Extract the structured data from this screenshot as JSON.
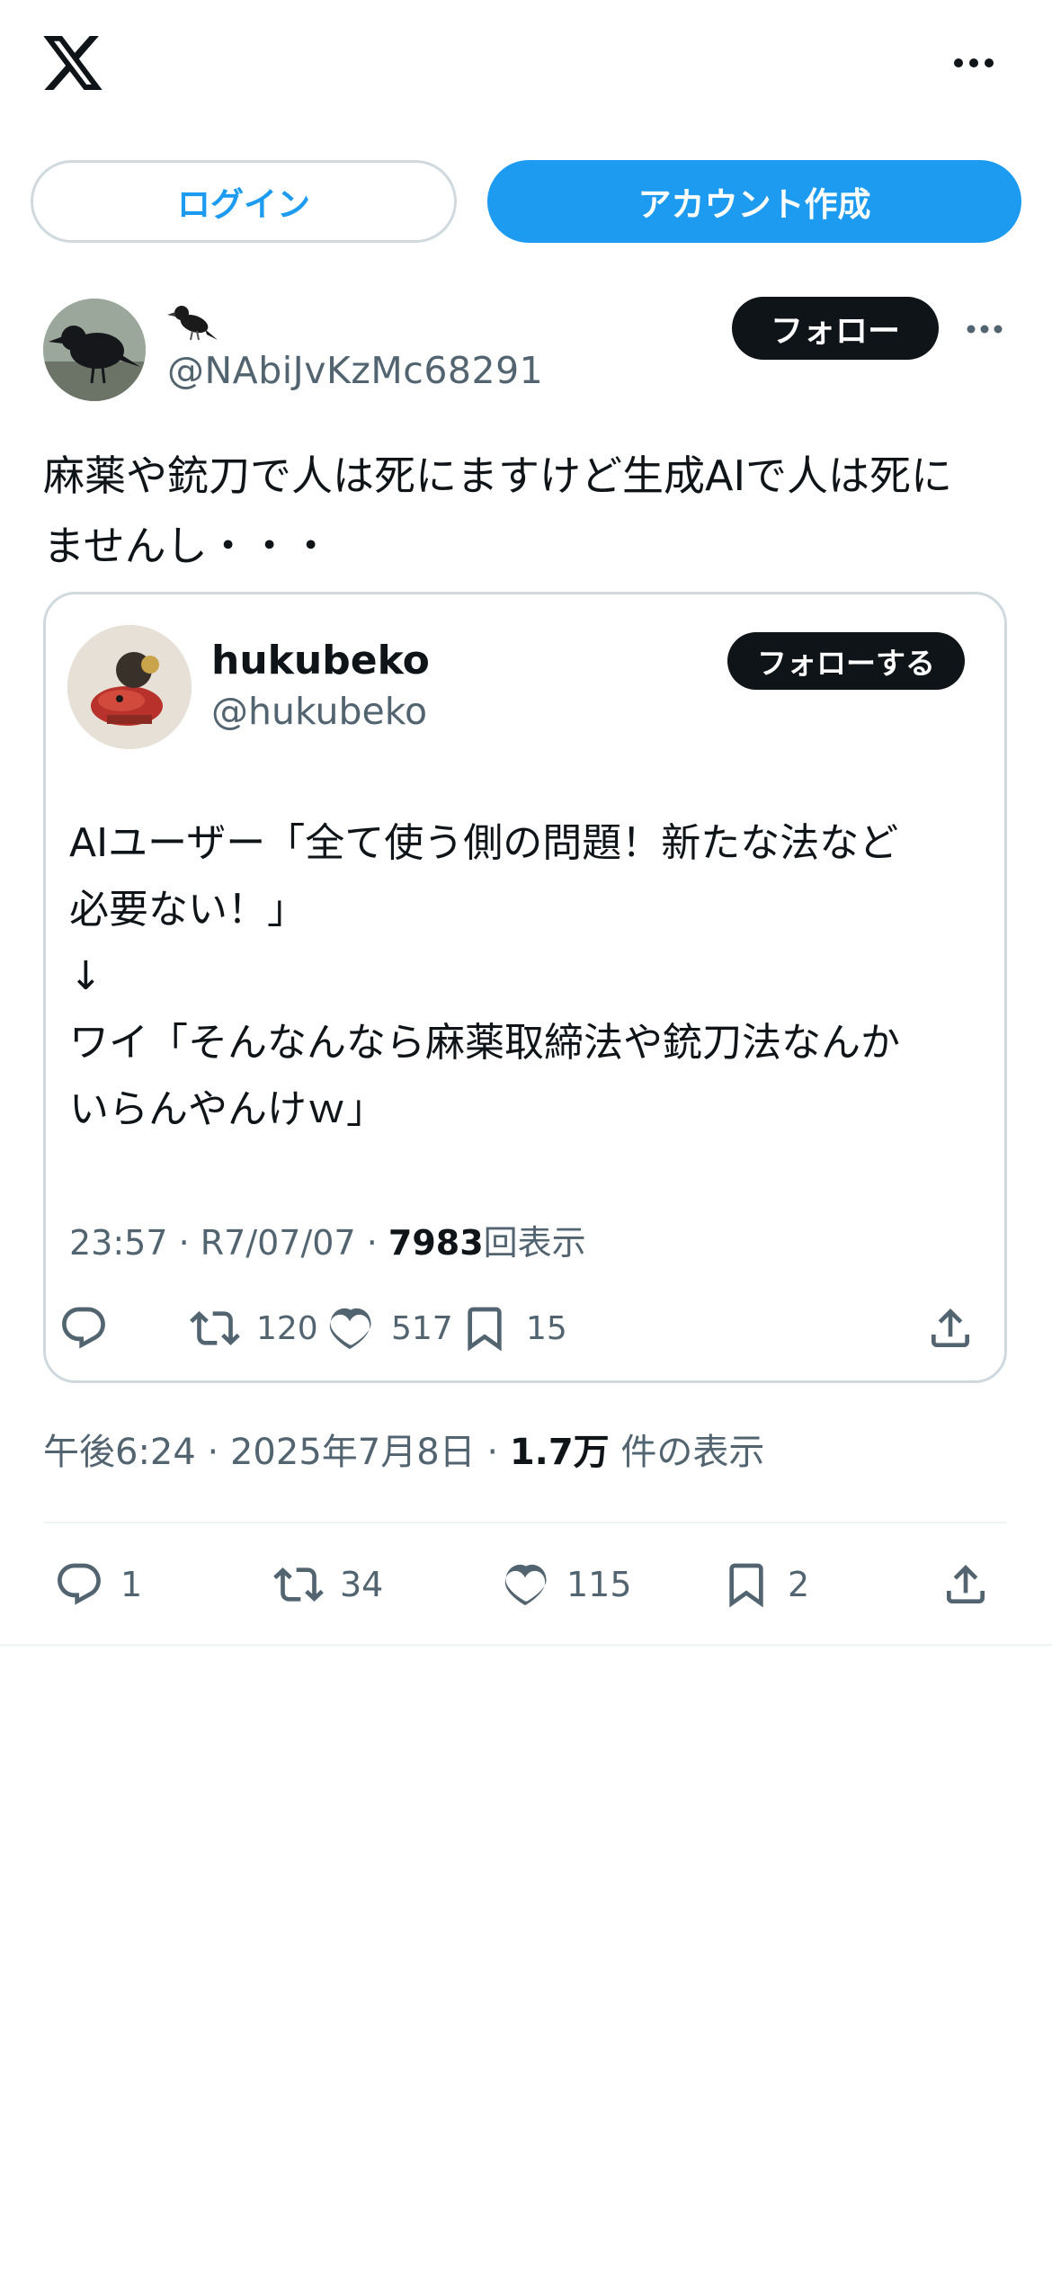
{
  "header": {
    "login_label": "ログイン",
    "signup_label": "アカウント作成"
  },
  "tweet": {
    "display_name_emoji": "crow",
    "handle": "@NAbiJvKzMc68291",
    "follow_label": "フォロー",
    "text_line1": "麻薬や銃刀で人は死にますけど生成AIで人は死に",
    "text_line2": "ませんし・・・",
    "timestamp": "午後6:24 · 2025年7月8日 · ",
    "views_count": "1.7万",
    "views_label": " 件の表示",
    "actions": {
      "reply": "1",
      "retweet": "34",
      "like": "115",
      "bookmark": "2"
    }
  },
  "quoted": {
    "name": "hukubeko",
    "handle": "@hukubeko",
    "follow_label": "フォローする",
    "lines": [
      "AIユーザー「全て使う側の問題！新たな法など",
      "必要ない！」",
      "↓",
      "ワイ「そんなんなら麻薬取締法や銃刀法なんか",
      "いらんやんけｗ」"
    ],
    "meta_time": "23:57 · R7/07/07 · ",
    "views_count": "7983",
    "views_label": "回表示",
    "actions": {
      "retweet": "120",
      "like": "517",
      "bookmark": "15"
    }
  },
  "colors": {
    "accent": "#1d9bf0",
    "text": "#0f1419",
    "secondary": "#536471",
    "border": "#cfd9de"
  }
}
